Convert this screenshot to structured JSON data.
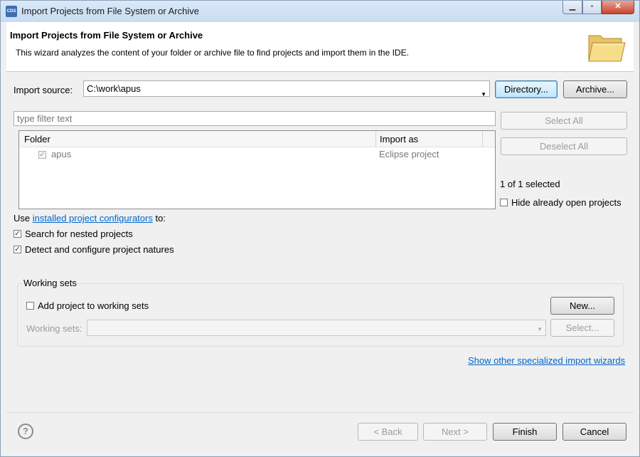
{
  "window": {
    "app_icon_text": "CDS",
    "title": "Import Projects from File System or Archive",
    "min_glyph": "▁",
    "max_glyph": "▫",
    "close_glyph": "✕"
  },
  "banner": {
    "title": "Import Projects from File System or Archive",
    "description": "This wizard analyzes the content of your folder or archive file to find projects and import them in the IDE.",
    "icon": "open-folder-icon"
  },
  "source": {
    "label": "Import source:",
    "value": "C:\\work\\apus",
    "directory_button": "Directory...",
    "archive_button": "Archive..."
  },
  "filter": {
    "placeholder": "type filter text"
  },
  "table": {
    "columns": [
      "Folder",
      "Import as"
    ],
    "rows": [
      {
        "folder": "apus",
        "import_as": "Eclipse project",
        "checked": true
      }
    ]
  },
  "side": {
    "select_all": "Select All",
    "deselect_all": "Deselect All",
    "selection_count": "1 of 1 selected",
    "hide_open_label": "Hide already open projects"
  },
  "configurators": {
    "prefix": "Use",
    "link": "installed project configurators",
    "suffix": "to:",
    "search_nested": "Search for nested projects",
    "detect_natures": "Detect and configure project natures"
  },
  "working_sets": {
    "legend": "Working sets",
    "add_label": "Add project to working sets",
    "new_button": "New...",
    "sets_label": "Working sets:",
    "select_button": "Select..."
  },
  "other_wizards_link": "Show other specialized import wizards",
  "footer": {
    "help": "?",
    "back": "< Back",
    "next": "Next >",
    "finish": "Finish",
    "cancel": "Cancel"
  },
  "colors": {
    "accent": "#0066cc",
    "title_bar": "#dbe9f8",
    "close_button": "#c8452f"
  }
}
